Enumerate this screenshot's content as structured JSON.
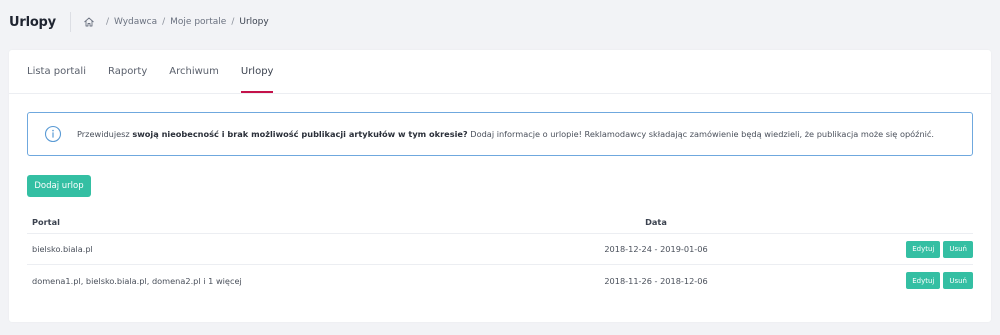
{
  "header": {
    "title": "Urlopy",
    "breadcrumb": [
      "Wydawca",
      "Moje portale",
      "Urlopy"
    ]
  },
  "tabs": [
    {
      "label": "Lista portali",
      "active": false
    },
    {
      "label": "Raporty",
      "active": false
    },
    {
      "label": "Archiwum",
      "active": false
    },
    {
      "label": "Urlopy",
      "active": true
    }
  ],
  "info": {
    "prefix": "Przewidujesz ",
    "bold": "swoją nieobecność i brak możliwość publikacji artykułów w tym okresie?",
    "suffix": " Dodaj informacje o urlopie! Reklamodawcy składając zamówienie będą wiedzieli, że publikacja może się opóźnić."
  },
  "add_button_label": "Dodaj urlop",
  "table": {
    "columns": {
      "portal": "Portal",
      "date": "Data"
    },
    "rows": [
      {
        "portal": "bielsko.biala.pl",
        "date": "2018-12-24 - 2019-01-06",
        "edit": "Edytuj",
        "delete": "Usuń"
      },
      {
        "portal": "domena1.pl, bielsko.biala.pl, domena2.pl i 1 więcej",
        "date": "2018-11-26 - 2018-12-06",
        "edit": "Edytuj",
        "delete": "Usuń"
      }
    ]
  },
  "colors": {
    "accent": "#34bfa3",
    "tab_underline": "#c4124a",
    "info_border": "#6fa8de"
  }
}
